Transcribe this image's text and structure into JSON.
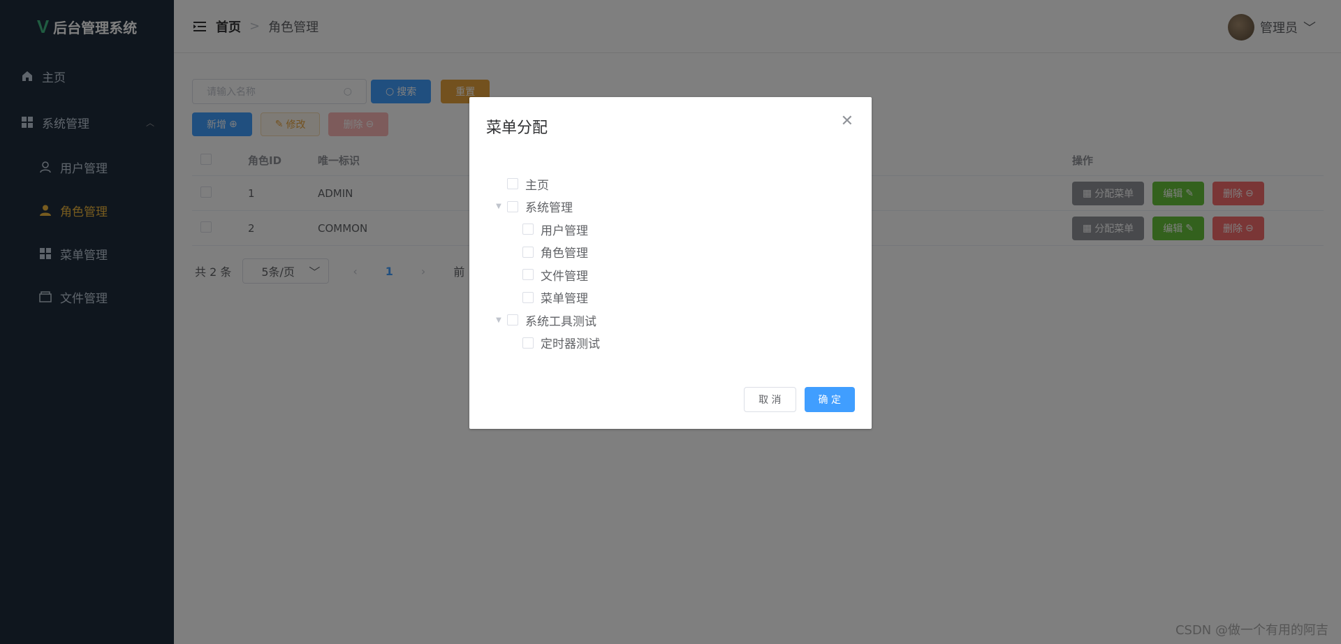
{
  "sidebar": {
    "logo_text": "后台管理系统",
    "items": [
      {
        "label": "主页"
      },
      {
        "label": "系统管理"
      },
      {
        "label": "用户管理"
      },
      {
        "label": "角色管理"
      },
      {
        "label": "菜单管理"
      },
      {
        "label": "文件管理"
      }
    ],
    "active_color": "#f0b83f"
  },
  "header": {
    "breadcrumb_home": "首页",
    "breadcrumb_sep": ">",
    "breadcrumb_current": "角色管理",
    "user_name": "管理员"
  },
  "search": {
    "placeholder": "请输入名称",
    "search_label": "搜索",
    "reset_label": "重置"
  },
  "actions": {
    "add_label": "新增",
    "edit_label": "修改",
    "delete_label": "删除"
  },
  "table": {
    "headers": [
      "角色ID",
      "唯一标识",
      "操作"
    ],
    "rows": [
      {
        "id": "1",
        "key": "ADMIN"
      },
      {
        "id": "2",
        "key": "COMMON"
      }
    ],
    "row_buttons": {
      "assign": "分配菜单",
      "edit": "编辑",
      "delete": "删除"
    }
  },
  "pager": {
    "total": "共 2 条",
    "size": "5条/页",
    "current": "1",
    "jump": "前"
  },
  "dialog": {
    "title": "菜单分配",
    "tree": [
      {
        "label": "主页",
        "level": 0,
        "expandable": false
      },
      {
        "label": "系统管理",
        "level": 0,
        "expandable": true
      },
      {
        "label": "用户管理",
        "level": 1
      },
      {
        "label": "角色管理",
        "level": 1
      },
      {
        "label": "文件管理",
        "level": 1
      },
      {
        "label": "菜单管理",
        "level": 1
      },
      {
        "label": "系统工具测试",
        "level": 0,
        "expandable": true
      },
      {
        "label": "定时器测试",
        "level": 1
      }
    ],
    "cancel_label": "取 消",
    "ok_label": "确 定"
  },
  "watermark": "CSDN @做一个有用的阿吉"
}
